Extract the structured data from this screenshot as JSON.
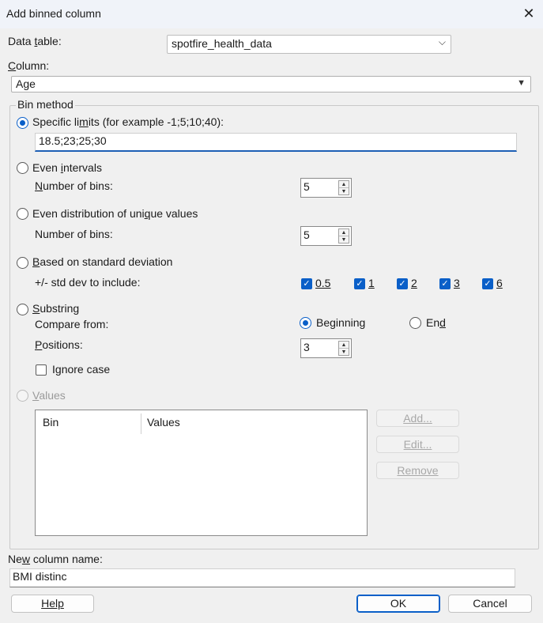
{
  "window": {
    "title": "Add binned column"
  },
  "data_table": {
    "label_pre": "Data ",
    "label_u": "t",
    "label_post": "able:",
    "value": "spotfire_health_data"
  },
  "column": {
    "label_pre": "",
    "label_u": "C",
    "label_post": "olumn:",
    "value": "Age"
  },
  "bin_method": {
    "group_label": "Bin method",
    "specific_limits": {
      "label_pre": "Specific li",
      "label_u": "m",
      "label_post": "its (for example -1;5;10;40):",
      "value": "18.5;23;25;30",
      "selected": true
    },
    "even_intervals": {
      "label_pre": "Even ",
      "label_u": "i",
      "label_post": "ntervals",
      "bins_pre": "",
      "bins_u": "N",
      "bins_post": "umber of bins:",
      "bins_value": "5"
    },
    "even_distribution": {
      "label_pre": "Even distribution of uni",
      "label_u": "q",
      "label_post": "ue values",
      "bins_pre": "Number of bins:",
      "bins_value": "5"
    },
    "std_dev": {
      "label_pre": "",
      "label_u": "B",
      "label_post": "ased on standard deviation",
      "include_label": "+/- std dev to include:",
      "options": [
        {
          "label": "0.5",
          "checked": true
        },
        {
          "label": "1",
          "checked": true
        },
        {
          "label": "2",
          "checked": true
        },
        {
          "label": "3",
          "checked": true
        },
        {
          "label": "6",
          "checked": true
        }
      ]
    },
    "substring": {
      "label_pre": "",
      "label_u": "S",
      "label_post": "ubstring",
      "compare_label": "Compare from:",
      "beginning_pre": "Be",
      "beginning_u": "g",
      "beginning_post": "inning",
      "beginning_selected": true,
      "end_pre": "En",
      "end_u": "d",
      "end_post": "",
      "positions_pre": "",
      "positions_u": "P",
      "positions_post": "ositions:",
      "positions_value": "3",
      "ignore_case_pre": "I",
      "ignore_case_u": "g",
      "ignore_case_post": "nore case",
      "ignore_case_checked": false
    },
    "values": {
      "label_pre": "",
      "label_u": "V",
      "label_post": "alues",
      "columns": [
        "Bin",
        "Values"
      ],
      "add_label": "Add...",
      "edit_label": "Edit...",
      "remove_label": "Remove"
    }
  },
  "new_column": {
    "label_pre": "Ne",
    "label_u": "w",
    "label_post": " column name:",
    "value": "BMI distinc"
  },
  "buttons": {
    "help": "Help",
    "ok": "OK",
    "cancel": "Cancel"
  }
}
